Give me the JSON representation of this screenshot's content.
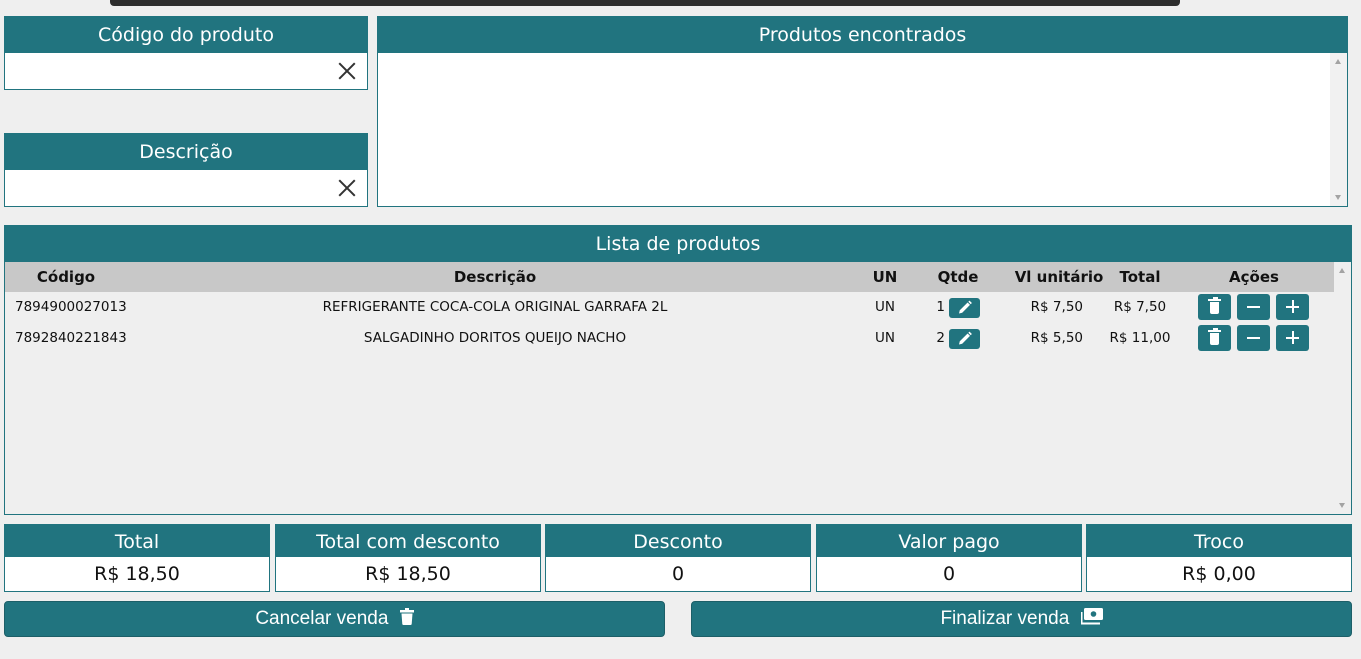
{
  "search": {
    "code_label": "Código do produto",
    "code_value": "",
    "description_label": "Descrição",
    "description_value": ""
  },
  "found": {
    "title": "Produtos encontrados"
  },
  "list": {
    "title": "Lista de produtos",
    "columns": {
      "code": "Código",
      "description": "Descrição",
      "unit": "UN",
      "qty": "Qtde",
      "unit_price": "Vl unitário",
      "total": "Total",
      "actions": "Ações"
    },
    "rows": [
      {
        "code": "7894900027013",
        "description": "REFRIGERANTE COCA-COLA ORIGINAL GARRAFA 2L",
        "unit": "UN",
        "qty": "1",
        "unit_price": "R$ 7,50",
        "total": "R$ 7,50"
      },
      {
        "code": "7892840221843",
        "description": "SALGADINHO DORITOS QUEIJO NACHO",
        "unit": "UN",
        "qty": "2",
        "unit_price": "R$ 5,50",
        "total": "R$ 11,00"
      }
    ]
  },
  "summary": [
    {
      "label": "Total",
      "value": "R$ 18,50"
    },
    {
      "label": "Total com desconto",
      "value": "R$ 18,50"
    },
    {
      "label": "Desconto",
      "value": "0"
    },
    {
      "label": "Valor pago",
      "value": "0"
    },
    {
      "label": "Troco",
      "value": "R$ 0,00"
    }
  ],
  "actions": {
    "cancel_label": "Cancelar venda",
    "finish_label": "Finalizar venda"
  },
  "icons": {
    "clear": "close-icon",
    "edit": "pencil-icon",
    "delete": "trash-icon",
    "decrease": "minus-icon",
    "increase": "plus-icon",
    "finish": "money-bill-icon"
  },
  "colors": {
    "accent": "#21747f",
    "header_row": "#c8c8c8",
    "background": "#efefef"
  }
}
